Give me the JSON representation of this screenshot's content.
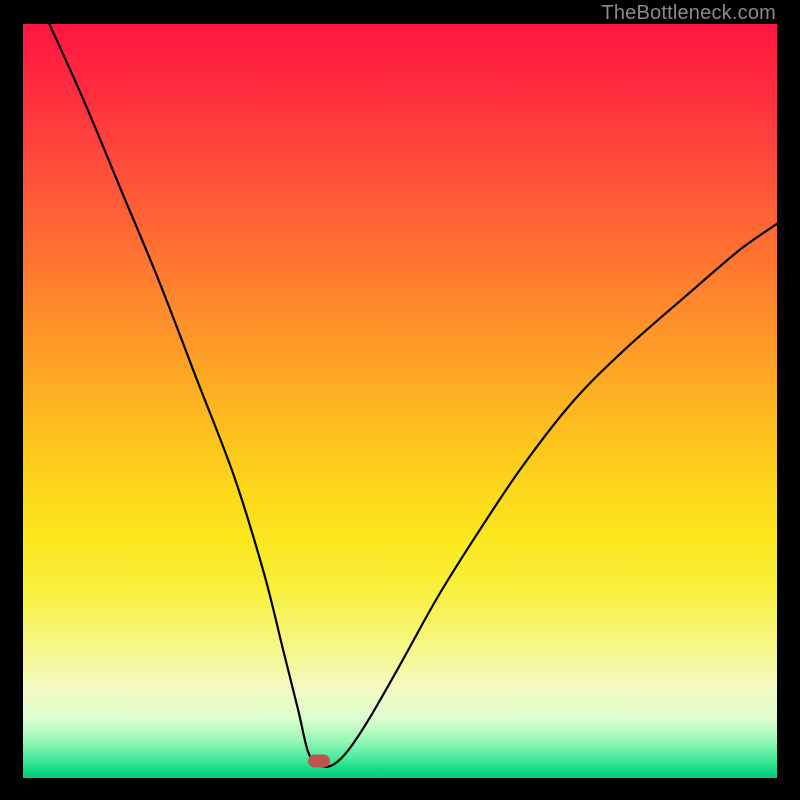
{
  "watermark": "TheBottleneck.com",
  "marker": {
    "x_frac": 0.392,
    "y_frac": 0.978,
    "color": "#c1534e"
  },
  "chart_data": {
    "type": "line",
    "title": "",
    "xlabel": "",
    "ylabel": "",
    "xlim": [
      0,
      1
    ],
    "ylim": [
      0,
      1
    ],
    "grid": false,
    "legend": false,
    "note": "V-shaped bottleneck curve. x is normalized horizontal position (0=left, 1=right). y is normalized vertical value (0=bottom, 1=top). Minimum near x≈0.39 where the curve touches the baseline.",
    "series": [
      {
        "name": "bottleneck-curve",
        "x": [
          0.035,
          0.08,
          0.13,
          0.18,
          0.23,
          0.28,
          0.32,
          0.345,
          0.365,
          0.378,
          0.392,
          0.41,
          0.43,
          0.46,
          0.5,
          0.55,
          0.6,
          0.66,
          0.73,
          0.8,
          0.88,
          0.95,
          1.0
        ],
        "y": [
          1.0,
          0.9,
          0.78,
          0.66,
          0.53,
          0.4,
          0.27,
          0.17,
          0.09,
          0.035,
          0.017,
          0.017,
          0.035,
          0.08,
          0.15,
          0.24,
          0.32,
          0.41,
          0.5,
          0.57,
          0.64,
          0.7,
          0.735
        ]
      }
    ],
    "marker_point": {
      "x": 0.392,
      "y": 0.022
    },
    "background_gradient": {
      "direction": "vertical",
      "stops": [
        {
          "pos": 0.0,
          "color": "#ff153f"
        },
        {
          "pos": 0.5,
          "color": "#feb321"
        },
        {
          "pos": 0.75,
          "color": "#f8f03e"
        },
        {
          "pos": 0.92,
          "color": "#dffcd0"
        },
        {
          "pos": 1.0,
          "color": "#06c878"
        }
      ]
    }
  }
}
